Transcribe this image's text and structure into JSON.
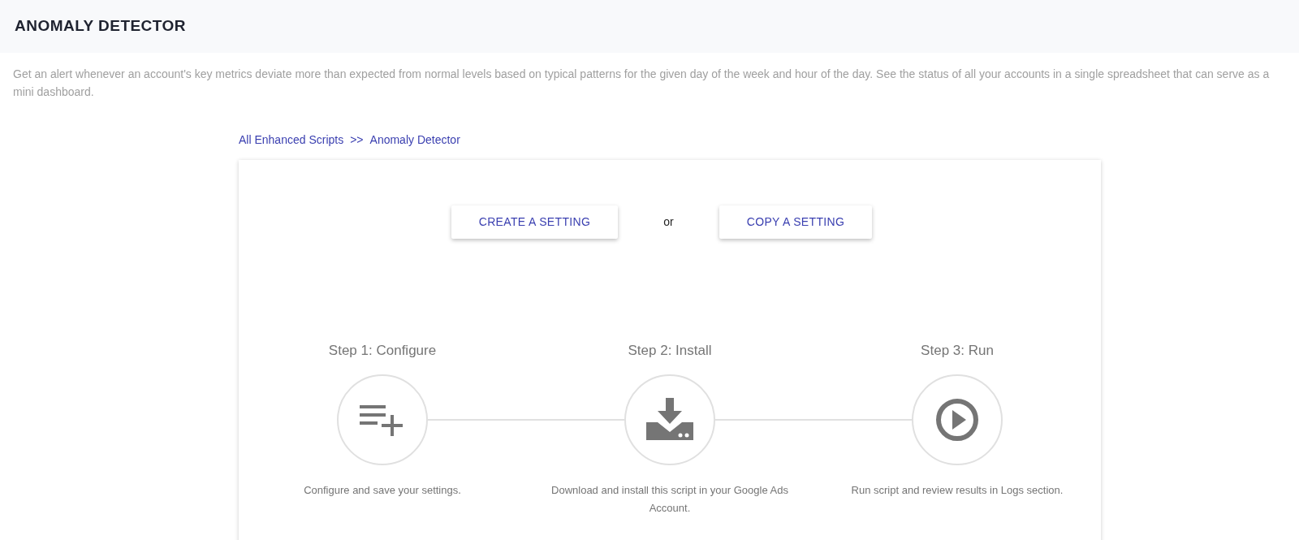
{
  "header": {
    "title": "ANOMALY DETECTOR"
  },
  "description": "Get an alert whenever an account's key metrics deviate more than expected from normal levels based on typical patterns for the given day of the week and hour of the day. See the status of all your accounts in a single spreadsheet that can serve as a mini dashboard.",
  "breadcrumb": {
    "items": [
      "All Enhanced Scripts",
      "Anomaly Detector"
    ],
    "separator": ">>"
  },
  "actions": {
    "buttons": [
      "CREATE A SETTING",
      "COPY A SETTING"
    ],
    "divider_text": "or"
  },
  "steps": [
    {
      "kind": "configure",
      "title": "Step 1: Configure",
      "text": "Configure and save your settings."
    },
    {
      "kind": "install",
      "title": "Step 2: Install",
      "text": "Download and install this script in your Google Ads Account."
    },
    {
      "kind": "run",
      "title": "Step 3: Run",
      "text": "Run script and review results in Logs section."
    }
  ]
}
